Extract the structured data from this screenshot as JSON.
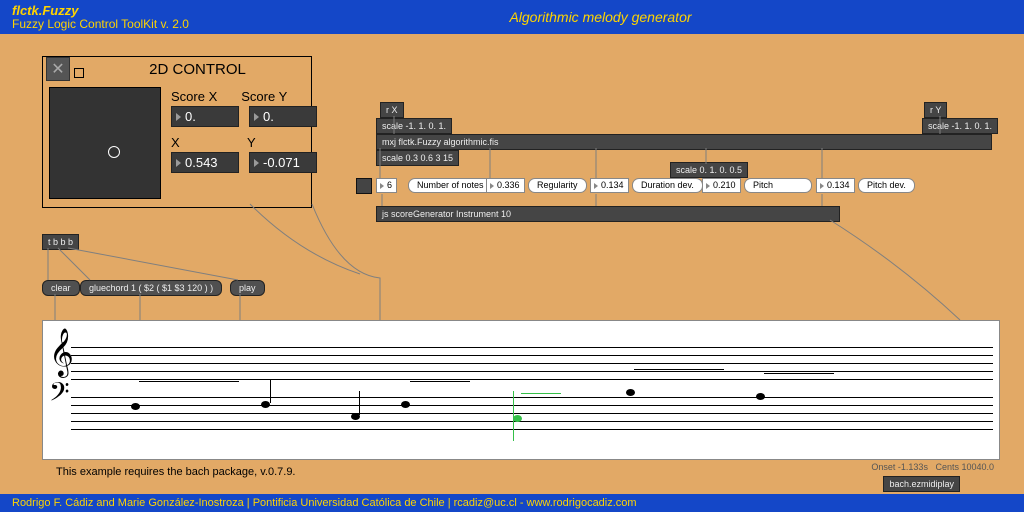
{
  "header": {
    "app_name": "flctk.Fuzzy",
    "subtitle": "Fuzzy Logic Control ToolKit v. 2.0",
    "center_title": "Algorithmic melody generator"
  },
  "footer": {
    "credits": "Rodrigo F. Cádiz and Marie González-Inostroza  |  Pontificia Universidad Católica de Chile | rcadiz@uc.cl - www.rodrigocadiz.com"
  },
  "control2d": {
    "title": "2D CONTROL",
    "labels": {
      "sx": "Score X",
      "sy": "Score Y",
      "x": "X",
      "y": "Y"
    },
    "values": {
      "sx": "0.",
      "sy": "0.",
      "x": "0.543",
      "y": "-0.071"
    }
  },
  "recv": {
    "x": "r X",
    "y": "r Y"
  },
  "scale": {
    "r": "scale -1. 1. 0. 1.",
    "l": "scale 0.3 0.6 3 15",
    "p": "scale 0. 1. 0. 0.5"
  },
  "fuzzy_obj": "mxj flctk.Fuzzy algorithmic.fis",
  "params": {
    "num_notes_val": "6",
    "num_notes_lbl": "Number of notes",
    "reg_val": "0.336",
    "reg_lbl": "Regularity",
    "dur_val": "0.134",
    "dur_lbl": "Duration dev.",
    "pitch_val": "0.210",
    "pitch_lbl": "Pitch",
    "pdev_val": "0.134",
    "pdev_lbl": "Pitch dev."
  },
  "scoregen": "js scoreGenerator Instrument 10",
  "tbbb": "t b b b",
  "controls": {
    "clear": "clear",
    "glue": "gluechord 1 ( $2 ( $1 $3 120 ) )",
    "play": "play"
  },
  "req_text": "This example requires the bach package, v.0.7.9.",
  "status": {
    "onset": "Onset -1.133s",
    "cents": "Cents 10040.0"
  },
  "ezmidi": "bach.ezmidiplay"
}
